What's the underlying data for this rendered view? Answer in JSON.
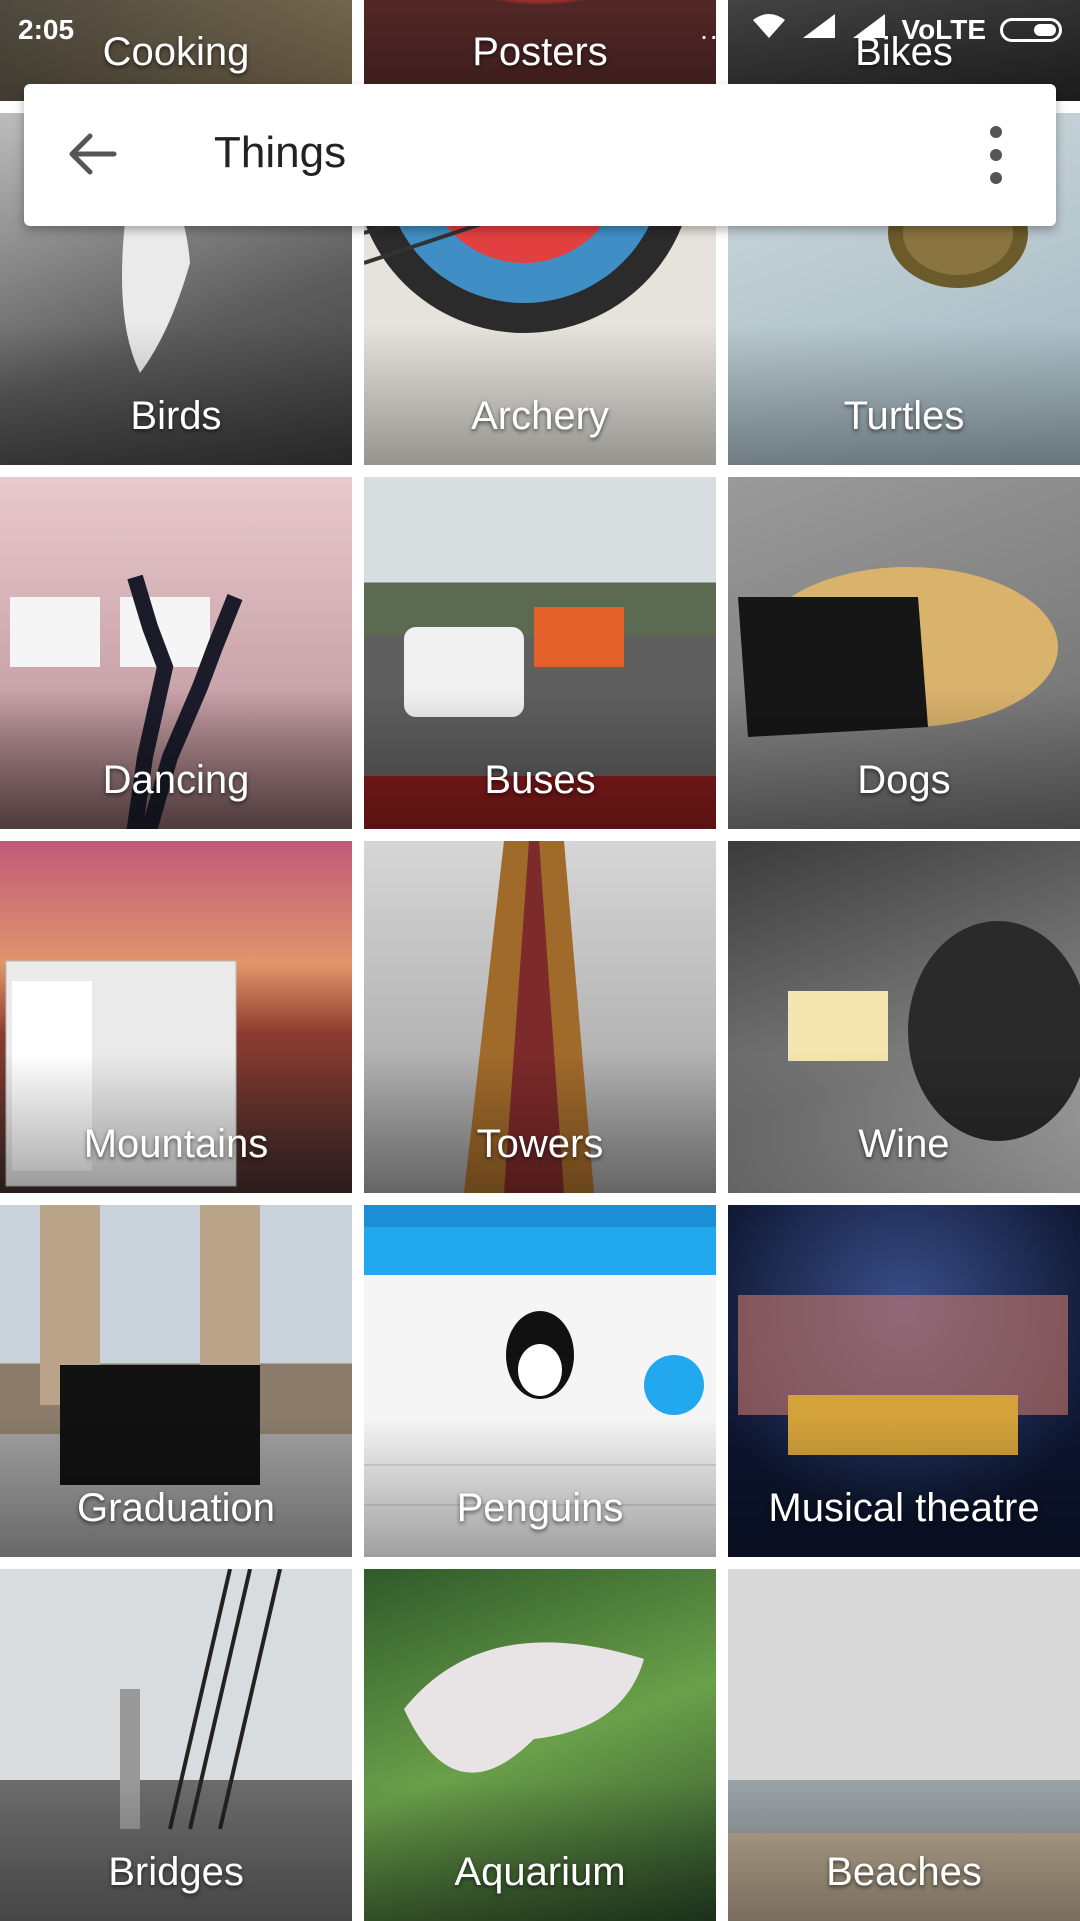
{
  "status": {
    "time": "2:05",
    "network": "VoLTE",
    "dots": "..."
  },
  "toolbar": {
    "title": "Things"
  },
  "categories": [
    {
      "label": "Cooking",
      "icon": "cooking-photo"
    },
    {
      "label": "Posters",
      "icon": "posters-photo"
    },
    {
      "label": "Bikes",
      "icon": "bikes-photo"
    },
    {
      "label": "Birds",
      "icon": "birds-photo"
    },
    {
      "label": "Archery",
      "icon": "archery-photo"
    },
    {
      "label": "Turtles",
      "icon": "turtles-photo"
    },
    {
      "label": "Dancing",
      "icon": "dancing-photo"
    },
    {
      "label": "Buses",
      "icon": "buses-photo"
    },
    {
      "label": "Dogs",
      "icon": "dogs-photo"
    },
    {
      "label": "Mountains",
      "icon": "mountains-photo"
    },
    {
      "label": "Towers",
      "icon": "towers-photo"
    },
    {
      "label": "Wine",
      "icon": "wine-photo"
    },
    {
      "label": "Graduation",
      "icon": "graduation-photo"
    },
    {
      "label": "Penguins",
      "icon": "penguins-photo"
    },
    {
      "label": "Musical theatre",
      "icon": "musical-theatre-photo"
    },
    {
      "label": "Bridges",
      "icon": "bridges-photo"
    },
    {
      "label": "Aquarium",
      "icon": "aquarium-photo"
    },
    {
      "label": "Beaches",
      "icon": "beaches-photo"
    }
  ]
}
